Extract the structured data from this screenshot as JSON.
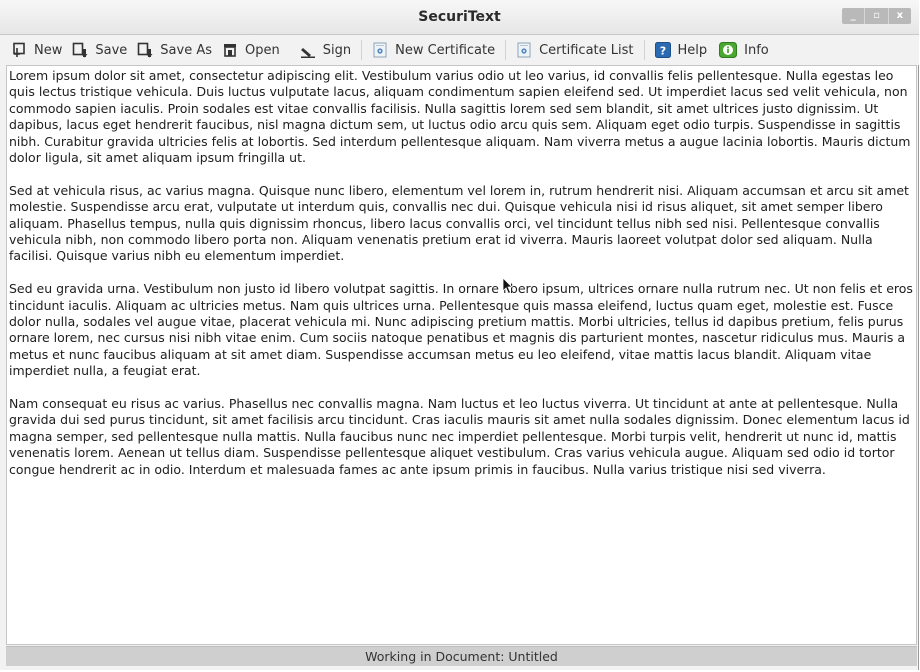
{
  "window": {
    "title": "SecuriText",
    "buttons": {
      "minimize": "_",
      "maximize": "▫",
      "close": "x"
    }
  },
  "toolbar": {
    "new_label": "New",
    "save_label": "Save",
    "save_as_label": "Save As",
    "open_label": "Open",
    "sign_label": "Sign",
    "new_certificate_label": "New Certificate",
    "certificate_list_label": "Certificate List",
    "help_label": "Help",
    "info_label": "Info"
  },
  "editor": {
    "paragraphs": [
      "Lorem ipsum dolor sit amet, consectetur adipiscing elit. Vestibulum varius odio ut leo varius, id convallis felis pellentesque. Nulla egestas leo quis lectus tristique vehicula. Duis luctus vulputate lacus, aliquam condimentum sapien eleifend sed. Ut imperdiet lacus sed velit vehicula, non commodo sapien iaculis. Proin sodales est vitae convallis facilisis. Nulla sagittis lorem sed sem blandit, sit amet ultrices justo dignissim. Ut dapibus, lacus eget hendrerit faucibus, nisl magna dictum sem, ut luctus odio arcu quis sem. Aliquam eget odio turpis. Suspendisse in sagittis nibh. Curabitur gravida ultricies felis at lobortis. Sed interdum pellentesque aliquam. Nam viverra metus a augue lacinia lobortis. Mauris dictum dolor ligula, sit amet aliquam ipsum fringilla ut.",
      "Sed at vehicula risus, ac varius magna. Quisque nunc libero, elementum vel lorem in, rutrum hendrerit nisi. Aliquam accumsan et arcu sit amet molestie. Suspendisse arcu erat, vulputate ut interdum quis, convallis nec dui. Quisque vehicula nisi id risus aliquet, sit amet semper libero aliquam. Phasellus tempus, nulla quis dignissim rhoncus, libero lacus convallis orci, vel tincidunt tellus nibh sed nisi. Pellentesque convallis vehicula nibh, non commodo libero porta non. Aliquam venenatis pretium erat id viverra. Mauris laoreet volutpat dolor sed aliquam. Nulla facilisi. Quisque varius nibh eu elementum imperdiet.",
      "Sed eu gravida urna. Vestibulum non justo id libero volutpat sagittis. In ornare libero ipsum, ultrices ornare nulla rutrum nec. Ut non felis et eros tincidunt iaculis. Aliquam ac ultricies metus. Nam quis ultrices urna. Pellentesque quis massa eleifend, luctus quam eget, molestie est. Fusce dolor nulla, sodales vel augue vitae, placerat vehicula mi. Nunc adipiscing pretium mattis. Morbi ultricies, tellus id dapibus pretium, felis purus ornare lorem, nec cursus nisi nibh vitae enim. Cum sociis natoque penatibus et magnis dis parturient montes, nascetur ridiculus mus. Mauris a metus et nunc faucibus aliquam at sit amet diam. Suspendisse accumsan metus eu leo eleifend, vitae mattis lacus blandit. Aliquam vitae imperdiet nulla, a feugiat erat.",
      "Nam consequat eu risus ac varius. Phasellus nec convallis magna. Nam luctus et leo luctus viverra. Ut tincidunt at ante at pellentesque. Nulla gravida dui sed purus tincidunt, sit amet facilisis arcu tincidunt. Cras iaculis mauris sit amet nulla sodales dignissim. Donec elementum lacus id magna semper, sed pellentesque nulla mattis. Nulla faucibus nunc nec imperdiet pellentesque. Morbi turpis velit, hendrerit ut nunc id, mattis venenatis lorem. Aenean ut tellus diam. Suspendisse pellentesque aliquet vestibulum. Cras varius vehicula augue. Aliquam sed odio id tortor congue hendrerit ac in odio. Interdum et malesuada fames ac ante ipsum primis in faucibus. Nulla varius tristique nisi sed viverra."
    ]
  },
  "status": {
    "text": "Working in Document: Untitled"
  },
  "icons": {
    "new": "new-document-icon",
    "save": "save-icon",
    "save_as": "save-as-icon",
    "open": "open-icon",
    "sign": "pen-icon",
    "new_certificate": "certificate-add-icon",
    "certificate_list": "certificate-list-icon",
    "help": "help-icon",
    "info": "info-icon"
  },
  "colors": {
    "help_icon": "#2a6ab3",
    "info_icon": "#4aa830",
    "statusbar": "#cfcfcf"
  }
}
